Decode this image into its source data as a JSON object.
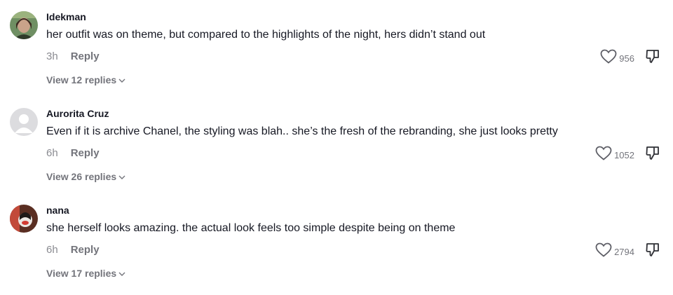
{
  "comments": [
    {
      "username": "Idekman",
      "text": "her outfit was on theme, but compared to the highlights of the night, hers didn’t stand out",
      "time": "3h",
      "reply_label": "Reply",
      "likes": "956",
      "view_replies": "View 12 replies",
      "avatar": "photo-avatar"
    },
    {
      "username": "Aurorita Cruz",
      "text": "Even if it is archive Chanel, the styling was blah.. she’s the fresh of the rebranding, she just looks pretty",
      "time": "6h",
      "reply_label": "Reply",
      "likes": "1052",
      "view_replies": "View 26 replies",
      "avatar": "default-avatar"
    },
    {
      "username": "nana",
      "text": "she herself looks amazing. the actual look feels too simple despite being on theme",
      "time": "6h",
      "reply_label": "Reply",
      "likes": "2794",
      "view_replies": "View 17 replies",
      "avatar": "photo-avatar"
    }
  ],
  "icons": {
    "like": "heart-outline-icon",
    "dislike": "thumbs-down-icon",
    "expand": "chevron-down-icon"
  },
  "colors": {
    "text": "#161823",
    "muted": "#73747b",
    "placeholder_avatar": "#d9d9dc"
  }
}
